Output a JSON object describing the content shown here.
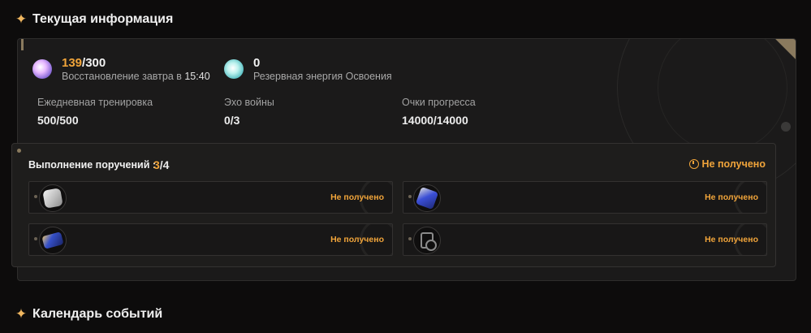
{
  "sections": {
    "current_info": "Текущая информация",
    "calendar": "Календарь событий"
  },
  "energy": {
    "current": "139",
    "max": "/300",
    "recovery_label": "Восстановление завтра в ",
    "recovery_time": "15:40",
    "icon": "waveplate-icon"
  },
  "reserve": {
    "value": "0",
    "label": "Резервная энергия Освоения",
    "icon": "reserve-energy-icon"
  },
  "metrics": [
    {
      "label": "Ежедневная тренировка",
      "value": "500/500"
    },
    {
      "label": "Эхо войны",
      "value": "0/3"
    },
    {
      "label": "Очки прогресса",
      "value": "14000/14000"
    }
  ],
  "tasks": {
    "title": "Выполнение поручений :",
    "done": "3",
    "total": "/4",
    "status": "Не получено",
    "items": [
      {
        "icon": "crystal-ore-icon",
        "status": "Не получено"
      },
      {
        "icon": "tuner-device-icon",
        "status": "Не получено"
      },
      {
        "icon": "ticket-card-icon",
        "status": "Не получено"
      },
      {
        "icon": "journal-timer-icon",
        "status": "Не получено"
      }
    ]
  },
  "colors": {
    "accent": "#f0a43a",
    "background": "#0d0c0c",
    "panel": "#1b1a1a"
  }
}
